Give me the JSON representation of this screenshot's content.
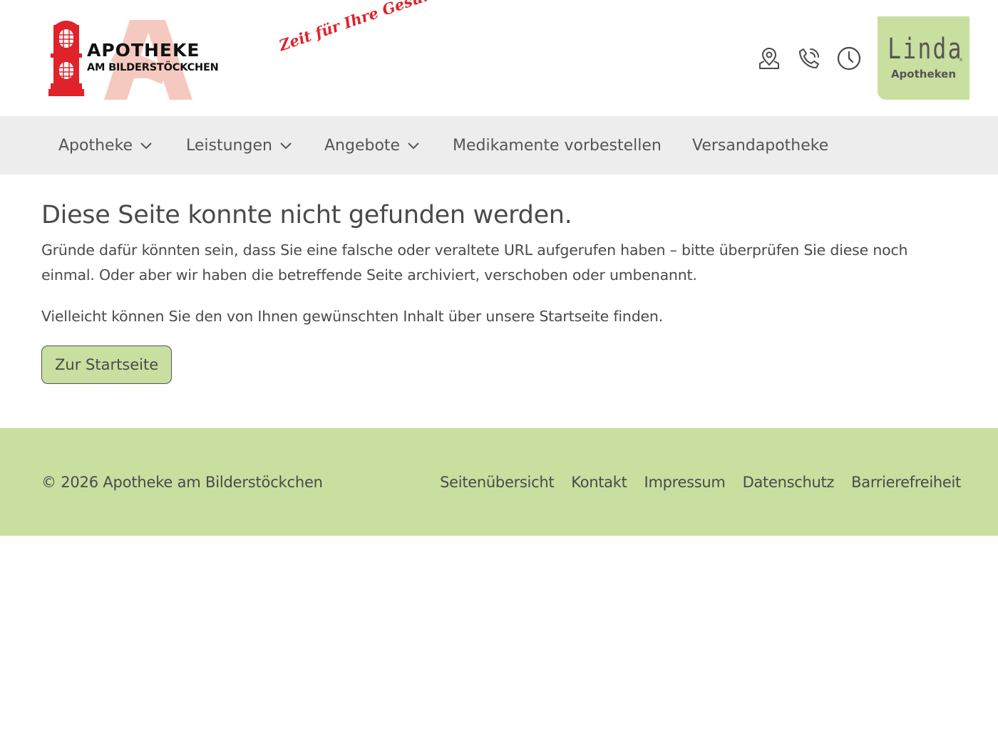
{
  "header": {
    "logo": {
      "line1": "APOTHEKE",
      "line2": "AM BILDERSTÖCKCHEN",
      "slogan": "Zeit für Ihre Gesundheit"
    },
    "icons": [
      "location-icon",
      "phone-icon",
      "clock-icon"
    ],
    "partner_logo": {
      "word": "Linda",
      "sub": "Apotheken",
      "reg": "®"
    }
  },
  "nav": {
    "items": [
      {
        "label": "Apotheke",
        "has_dropdown": true
      },
      {
        "label": "Leistungen",
        "has_dropdown": true
      },
      {
        "label": "Angebote",
        "has_dropdown": true
      },
      {
        "label": "Medikamente vorbestellen",
        "has_dropdown": false
      },
      {
        "label": "Versandapotheke",
        "has_dropdown": false
      }
    ]
  },
  "main": {
    "title": "Diese Seite konnte nicht gefunden werden.",
    "paragraph1": "Gründe dafür könnten sein, dass Sie eine falsche oder veraltete URL aufgerufen haben – bitte überprüfen Sie diese noch einmal. Oder aber wir haben die betreffende Seite archiviert, verschoben oder umbenannt.",
    "paragraph2": "Vielleicht können Sie den von Ihnen gewünschten Inhalt über unsere Startseite finden.",
    "button_label": "Zur Startseite"
  },
  "footer": {
    "copyright": "© 2026 Apotheke am Bilderstöckchen",
    "links": [
      "Seitenübersicht",
      "Kontakt",
      "Impressum",
      "Datenschutz",
      "Barrierefreiheit"
    ]
  },
  "colors": {
    "accent_green": "#c8df9f",
    "nav_bg": "#ededed",
    "brand_red": "#e0222a",
    "text": "#4a4a4a"
  }
}
